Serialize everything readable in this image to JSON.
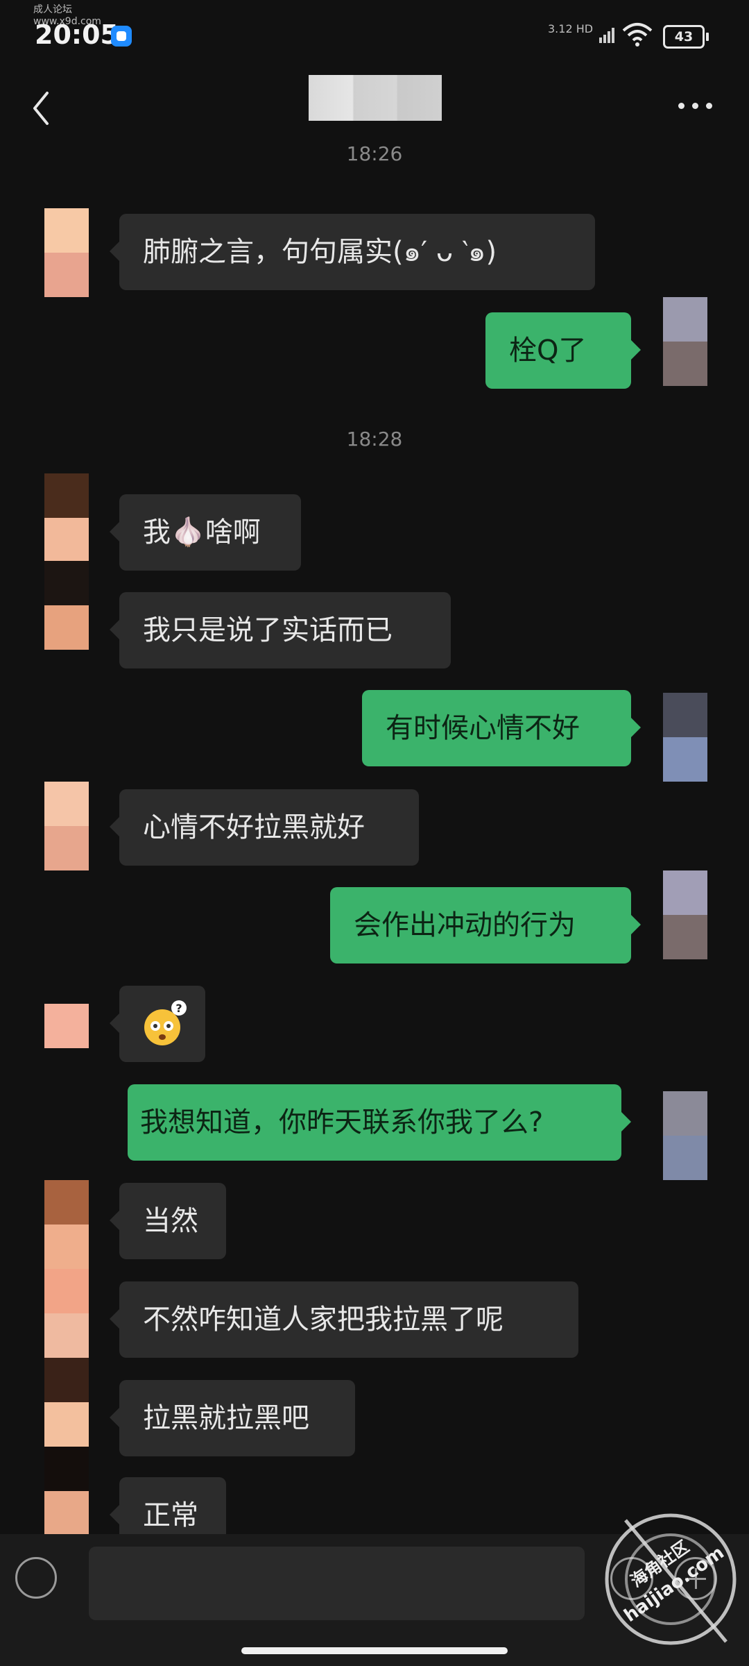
{
  "watermark_top": {
    "line1": "成人论坛",
    "line2": "www.x9d.com"
  },
  "status": {
    "time": "20:05",
    "speed": "3.12",
    "net": "HD",
    "battery": "43"
  },
  "header": {
    "title_hidden": true
  },
  "timestamps": [
    "18:26",
    "18:28"
  ],
  "messages": [
    {
      "side": "in",
      "text": "肺腑之言，句句属实(๑′ ᴗ ‵๑)"
    },
    {
      "side": "out",
      "text": "栓Q了"
    },
    {
      "side": "in",
      "text": "我🧄啥啊"
    },
    {
      "side": "in",
      "text": "我只是说了实话而已"
    },
    {
      "side": "out",
      "text": "有时候心情不好"
    },
    {
      "side": "in",
      "text": "心情不好拉黑就好"
    },
    {
      "side": "out",
      "text": "会作出冲动的行为"
    },
    {
      "side": "in",
      "text": "",
      "sticker": "confused-face-sticker"
    },
    {
      "side": "out",
      "text": "我想知道，你昨天联系你我了么?"
    },
    {
      "side": "in",
      "text": "当然"
    },
    {
      "side": "in",
      "text": "不然咋知道人家把我拉黑了呢"
    },
    {
      "side": "in",
      "text": "拉黑就拉黑吧"
    },
    {
      "side": "in",
      "text": "正常"
    }
  ],
  "watermark": {
    "line1": "海角社区",
    "line2": "haijiao.com"
  },
  "colors": {
    "background": "#111111",
    "incoming_bubble": "#2c2c2c",
    "outgoing_bubble": "#3bb36b"
  }
}
